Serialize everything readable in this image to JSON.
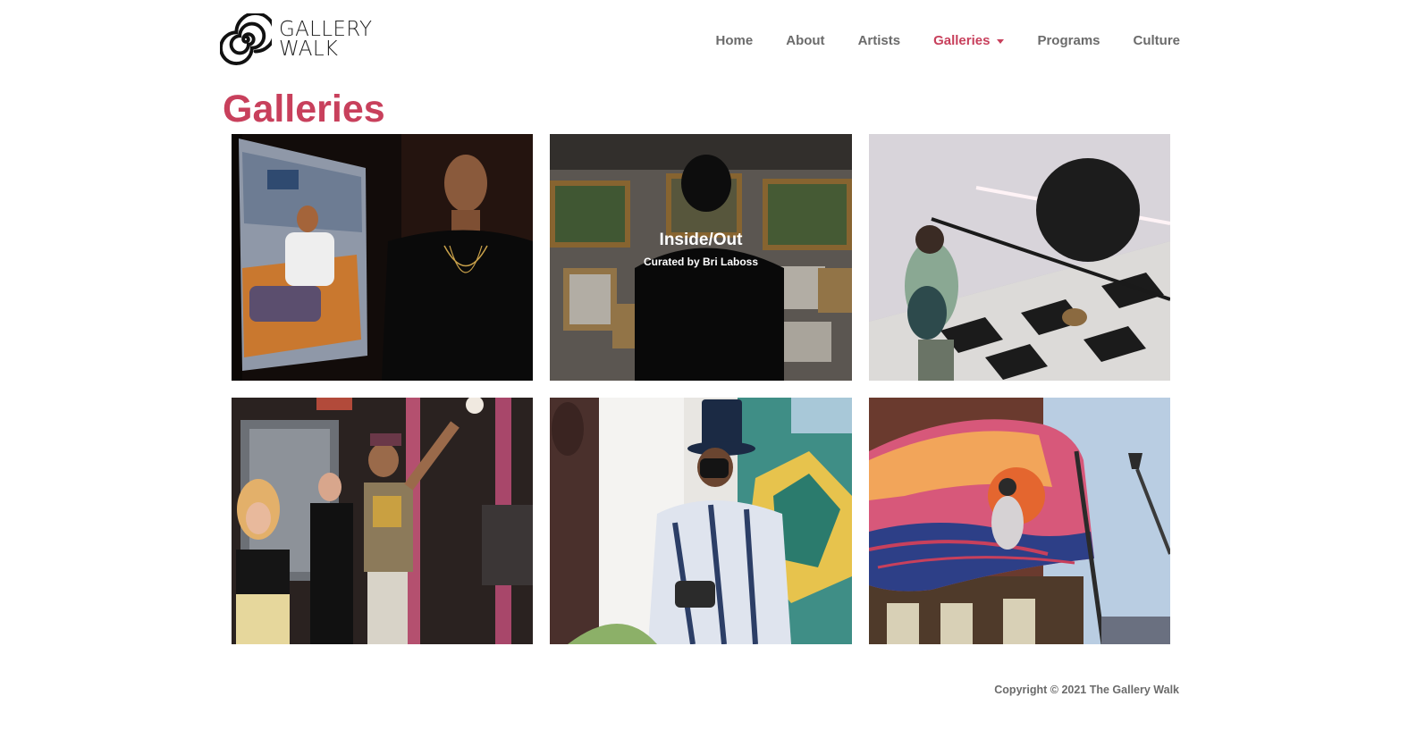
{
  "brand": {
    "line1": "GALLERY",
    "line2": "WALK",
    "icon": "spiral-logo-icon"
  },
  "nav": {
    "items": [
      {
        "label": "Home"
      },
      {
        "label": "About"
      },
      {
        "label": "Artists"
      },
      {
        "label": "Galleries",
        "active": true,
        "icon": "caret-down-icon"
      },
      {
        "label": "Programs"
      },
      {
        "label": "Culture"
      }
    ]
  },
  "page": {
    "title": "Galleries"
  },
  "galleries": [
    {
      "id": 1
    },
    {
      "id": 2,
      "title": "Inside/Out",
      "curator": "Curated by Bri Laboss"
    },
    {
      "id": 3
    },
    {
      "id": 4
    },
    {
      "id": 5
    },
    {
      "id": 6
    }
  ],
  "footer": {
    "copyright": "Copyright © 2021 The Gallery Walk"
  },
  "colors": {
    "accent": "#c8405c",
    "nav_text": "#6b6b6b",
    "background": "#ffffff"
  }
}
